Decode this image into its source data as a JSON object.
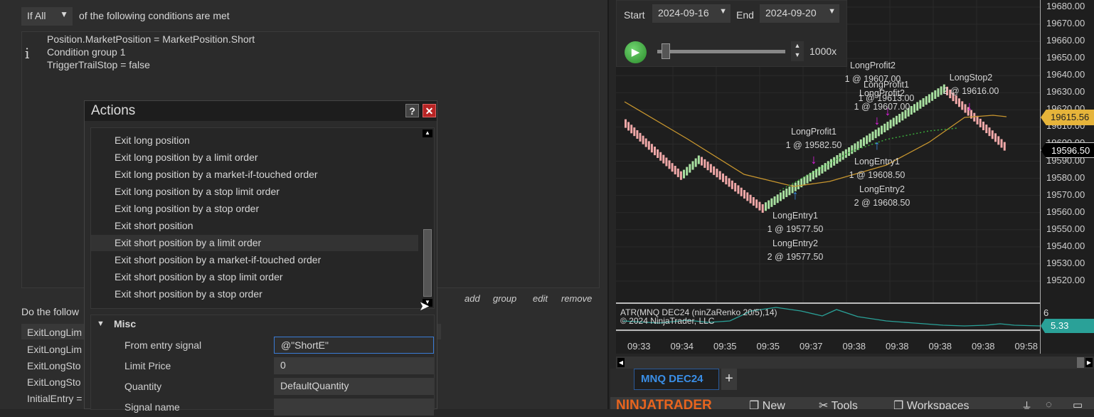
{
  "conditions": {
    "mode_select": "If All",
    "mode_suffix": "of the following conditions are met",
    "lines": [
      "Position.MarketPosition = MarketPosition.Short",
      "Condition group 1",
      "TriggerTrailStop = false"
    ],
    "info_icon": "i"
  },
  "actions_dialog": {
    "title": "Actions",
    "help_label": "?",
    "close_label": "✕",
    "items": [
      "Exit long position",
      "Exit long position by a limit order",
      "Exit long position by a market-if-touched order",
      "Exit long position by a stop limit order",
      "Exit long position by a stop order",
      "Exit short position",
      "Exit short position by a limit order",
      "Exit short position by a market-if-touched order",
      "Exit short position by a stop limit order",
      "Exit short position by a stop order"
    ],
    "selected_index": 6,
    "section": "Misc",
    "properties": [
      {
        "label": "From entry signal",
        "value": "@\"ShortE\""
      },
      {
        "label": "Limit Price",
        "value": "0"
      },
      {
        "label": "Quantity",
        "value": "DefaultQuantity"
      },
      {
        "label": "Signal name",
        "value": ""
      }
    ]
  },
  "condition_links": {
    "add": "add",
    "group": "group",
    "edit": "edit",
    "remove": "remove"
  },
  "actions_section": {
    "heading": "Do the follow",
    "rows": [
      "ExitLongLim",
      "ExitLongLim",
      "ExitLongSto",
      "ExitLongSto",
      "InitialEntry ="
    ]
  },
  "playback": {
    "start_label": "Start",
    "start_date": "2024-09-16",
    "end_label": "End",
    "end_date": "2024-09-20",
    "speed": "1000x",
    "slider_fraction": 0.07
  },
  "chart": {
    "price_ticks": [
      "19680.00",
      "19670.00",
      "19660.00",
      "19650.00",
      "19640.00",
      "19630.00",
      "19620.00",
      "19610.00",
      "19600.00",
      "19590.00",
      "19580.00",
      "19570.00",
      "19560.00",
      "19550.00",
      "19540.00",
      "19530.00",
      "19520.00"
    ],
    "last_price_gold": "19615.56",
    "last_price": "19596.50",
    "indicator_label": "ATR(MNQ DEC24 (ninZaRenko 20/5),14)",
    "copyright": "© 2024 NinjaTrader, LLC",
    "indicator_tick": "6",
    "indicator_value": "5.33",
    "time_ticks": [
      "09:33",
      "09:34",
      "09:35",
      "09:35",
      "09:37",
      "09:38",
      "09:38",
      "09:38",
      "09:38",
      "09:58"
    ],
    "annotations": [
      {
        "name": "LongProfit2",
        "qty": "1 @ 19607.00"
      },
      {
        "name": "LongProfit1",
        "qty": "1 @ 19613.00"
      },
      {
        "name": "LongProfit2",
        "qty": "1 @ 19607.00"
      },
      {
        "name": "LongStop2",
        "qty": "2 @ 19616.00"
      },
      {
        "name": "LongProfit1",
        "qty": "1 @ 19582.50"
      },
      {
        "name": "LongEntry1",
        "qty": "1 @ 19608.50"
      },
      {
        "name": "LongEntry2",
        "qty": "2 @ 19608.50"
      },
      {
        "name": "LongEntry1",
        "qty": "1 @ 19577.50"
      },
      {
        "name": "LongEntry2",
        "qty": "2 @ 19577.50"
      }
    ],
    "price_path": [
      19612,
      19580,
      19590,
      19561,
      19631,
      19597
    ],
    "colors": {
      "up": "#a8e0a0",
      "down": "#f0a8a8",
      "ma": "#c8962e",
      "atr": "#2aa198",
      "gold": "#e6b43a"
    }
  },
  "tabs": {
    "active": "MNQ DEC24",
    "add": "+"
  },
  "taskbar": {
    "brand": "NINJATRADER",
    "new": "New",
    "tools": "Tools",
    "workspaces": "Workspaces"
  }
}
